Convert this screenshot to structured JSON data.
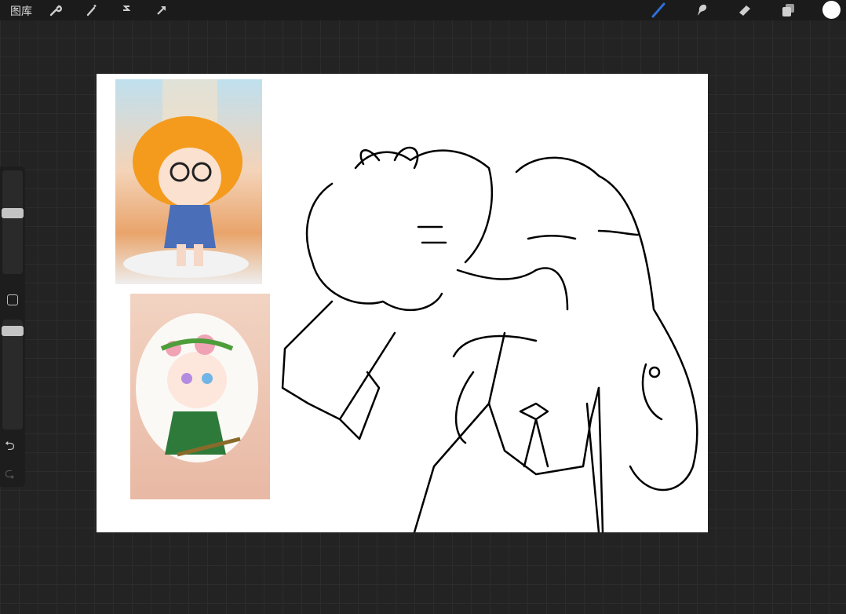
{
  "topbar": {
    "gallery_label": "图库",
    "left_tools": [
      "wrench-icon",
      "magic-wand-icon",
      "selection-icon",
      "transform-arrow-icon"
    ],
    "right_tools": [
      "brush-icon",
      "smudge-icon",
      "eraser-icon",
      "layers-icon",
      "color-swatch"
    ],
    "active_tool_color": "#2f6fd6",
    "current_color": "#ffffff"
  },
  "sidebar": {
    "brush_size": 0.59,
    "opacity": 0.9,
    "modify_button": "modify-square",
    "undo": "undo-icon",
    "redo": "redo-icon"
  }
}
